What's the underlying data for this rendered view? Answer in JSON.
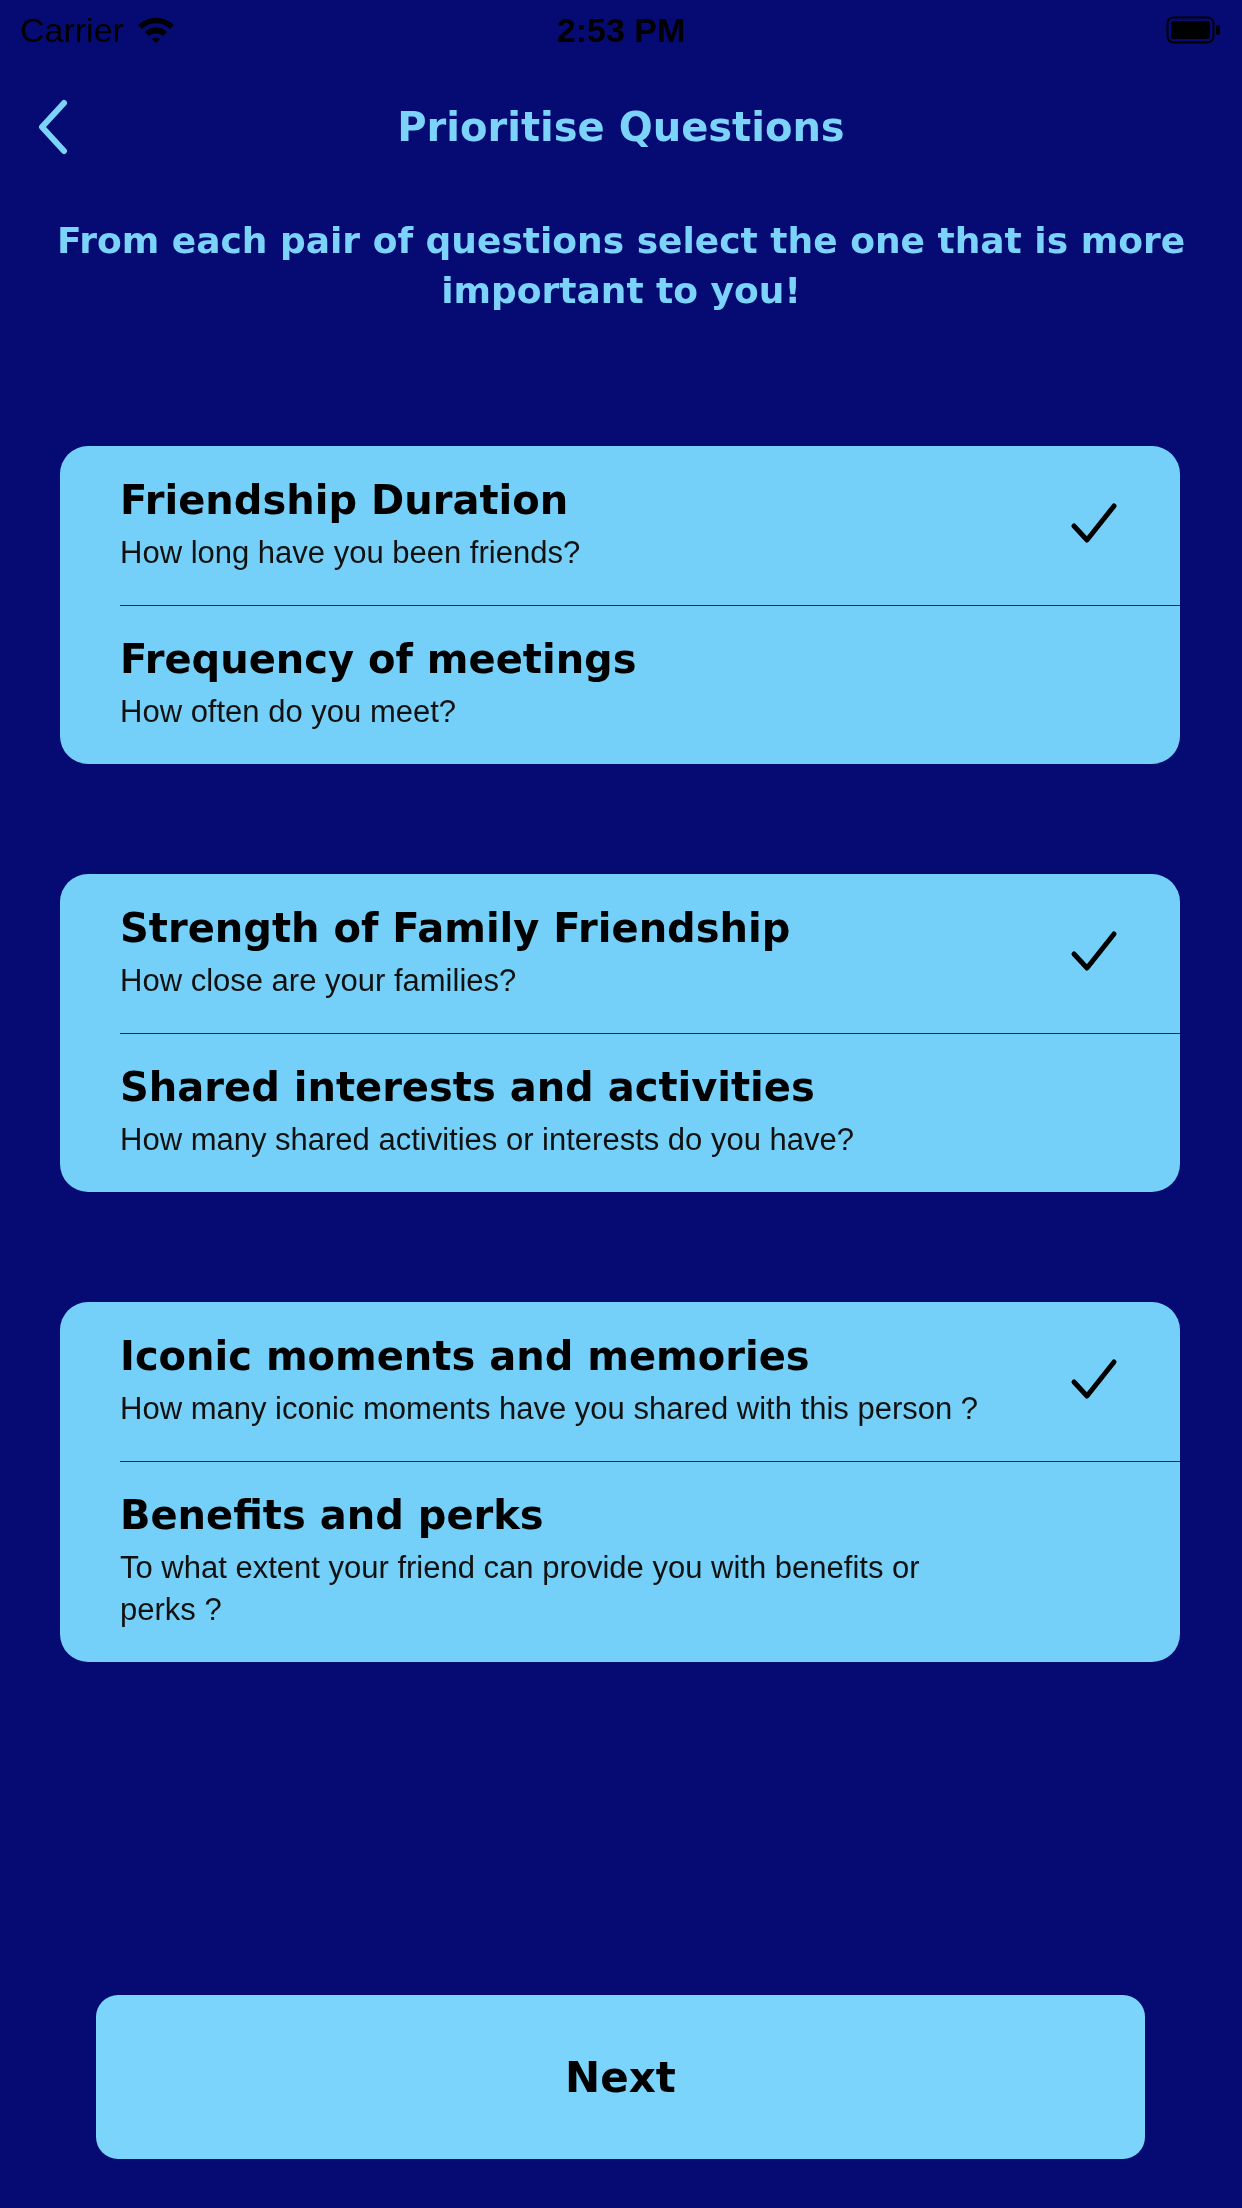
{
  "status_bar": {
    "carrier": "Carrier",
    "time": "2:53 PM"
  },
  "nav": {
    "title": "Prioritise Questions"
  },
  "instruction": "From each pair of questions select the one that is more important to you!",
  "pairs": [
    {
      "options": [
        {
          "title": "Friendship Duration",
          "subtitle": "How long have you been friends?",
          "selected": true
        },
        {
          "title": "Frequency of meetings",
          "subtitle": "How often do you meet?",
          "selected": false
        }
      ]
    },
    {
      "options": [
        {
          "title": "Strength of Family Friendship",
          "subtitle": "How close are your families?",
          "selected": true
        },
        {
          "title": "Shared interests and activities",
          "subtitle": "How many shared activities or interests do you have?",
          "selected": false
        }
      ]
    },
    {
      "options": [
        {
          "title": "Iconic moments and memories",
          "subtitle": "How many iconic moments have you shared with this person ?",
          "selected": true
        },
        {
          "title": "Benefits and perks",
          "subtitle": "To what extent your friend can provide you with benefits or perks ?",
          "selected": false
        }
      ]
    }
  ],
  "next_button": "Next"
}
